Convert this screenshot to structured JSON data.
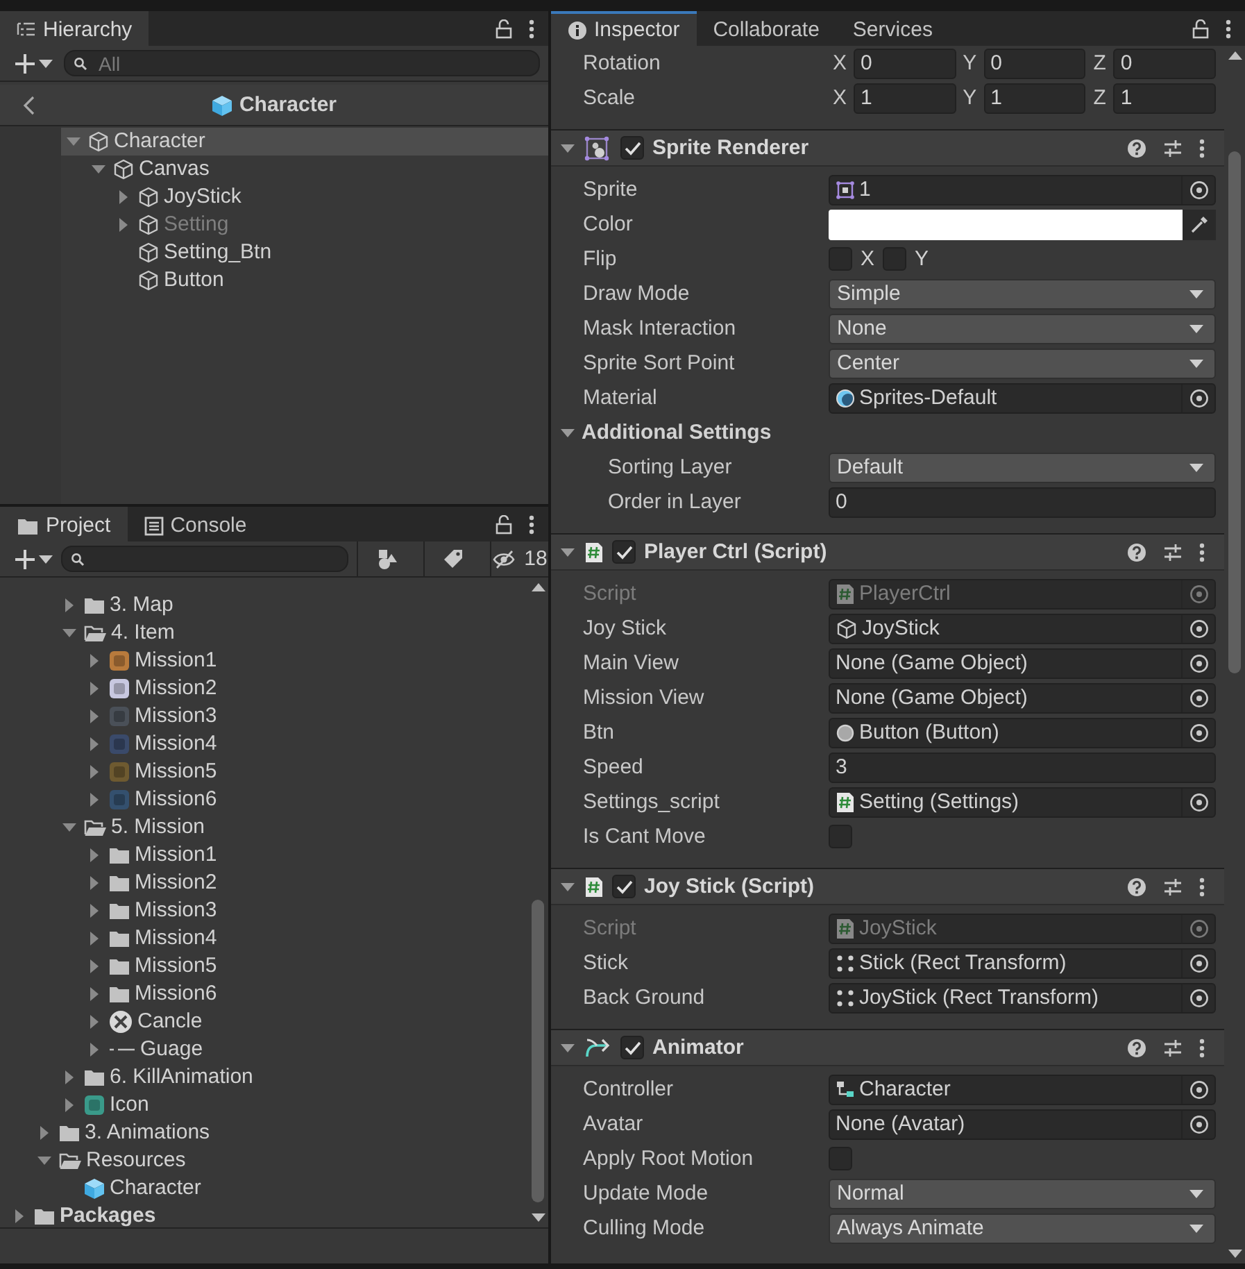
{
  "hierarchy": {
    "tab": {
      "label": "Hierarchy",
      "selected": true
    },
    "search": {
      "placeholder": "All"
    },
    "breadcrumb": "Character",
    "tree": [
      {
        "label": "Character",
        "kind": "gameobject",
        "expanded": true,
        "selected": true,
        "active": true,
        "children": [
          {
            "label": "Canvas",
            "kind": "gameobject",
            "expanded": true,
            "selected": false,
            "active": true,
            "children": [
              {
                "label": "JoyStick",
                "kind": "gameobject",
                "expanded": false,
                "selected": false,
                "active": true
              },
              {
                "label": "Setting",
                "kind": "gameobject",
                "expanded": false,
                "selected": false,
                "active": false
              },
              {
                "label": "Setting_Btn",
                "kind": "gameobject",
                "selected": false,
                "active": true
              },
              {
                "label": "Button",
                "kind": "gameobject",
                "selected": false,
                "active": true
              }
            ]
          }
        ]
      }
    ]
  },
  "project": {
    "tabs": [
      {
        "label": "Project",
        "kind": "folder",
        "selected": true
      },
      {
        "label": "Console",
        "kind": "console",
        "selected": false
      }
    ],
    "hidden_count": "18",
    "tree": [
      {
        "children": [
          {
            "children": [
              {
                "label": "3. Map",
                "kind": "folder",
                "expanded": false
              },
              {
                "label": "4. Item",
                "kind": "folder",
                "expanded": true,
                "children": [
                  {
                    "label": "Mission1",
                    "kind": "thumb",
                    "color": "#b87a3c",
                    "expanded": false
                  },
                  {
                    "label": "Mission2",
                    "kind": "thumb",
                    "color": "#c8c8e0",
                    "expanded": false
                  },
                  {
                    "label": "Mission3",
                    "kind": "thumb",
                    "color": "#4a5058",
                    "expanded": false
                  },
                  {
                    "label": "Mission4",
                    "kind": "thumb",
                    "color": "#3a4a6a",
                    "expanded": false
                  },
                  {
                    "label": "Mission5",
                    "kind": "thumb",
                    "color": "#6e5a30",
                    "expanded": false
                  },
                  {
                    "label": "Mission6",
                    "kind": "thumb",
                    "color": "#34506e",
                    "expanded": false
                  }
                ]
              },
              {
                "label": "5. Mission",
                "kind": "folder",
                "expanded": true,
                "children": [
                  {
                    "label": "Mission1",
                    "kind": "folder",
                    "expanded": false
                  },
                  {
                    "label": "Mission2",
                    "kind": "folder",
                    "expanded": false
                  },
                  {
                    "label": "Mission3",
                    "kind": "folder",
                    "expanded": false
                  },
                  {
                    "label": "Mission4",
                    "kind": "folder",
                    "expanded": false
                  },
                  {
                    "label": "Mission5",
                    "kind": "folder",
                    "expanded": false
                  },
                  {
                    "label": "Mission6",
                    "kind": "folder",
                    "expanded": false
                  },
                  {
                    "label": "Cancle",
                    "kind": "cancel",
                    "expanded": false
                  },
                  {
                    "label": "Guage",
                    "kind": "gauge",
                    "expanded": false
                  }
                ]
              },
              {
                "label": "6. KillAnimation",
                "kind": "folder",
                "expanded": false
              },
              {
                "label": "Icon",
                "kind": "thumb",
                "color": "#3a9a8a",
                "expanded": false
              }
            ]
          },
          {
            "label": "3. Animations",
            "kind": "folder",
            "expanded": false
          },
          {
            "label": "Resources",
            "kind": "folder",
            "expanded": true,
            "children": [
              {
                "label": "Character",
                "kind": "prefab"
              }
            ]
          }
        ]
      },
      {
        "label": "Packages",
        "kind": "folder",
        "expanded": false,
        "bold": true
      }
    ]
  },
  "inspector": {
    "tabs": [
      {
        "label": "Inspector",
        "selected": true
      },
      {
        "label": "Collaborate",
        "selected": false
      },
      {
        "label": "Services",
        "selected": false
      }
    ],
    "transform_rows": [
      {
        "label": "Rotation",
        "axes": [
          {
            "axis": "X",
            "value": "0"
          },
          {
            "axis": "Y",
            "value": "0"
          },
          {
            "axis": "Z",
            "value": "0"
          }
        ]
      },
      {
        "label": "Scale",
        "axes": [
          {
            "axis": "X",
            "value": "1"
          },
          {
            "axis": "Y",
            "value": "1"
          },
          {
            "axis": "Z",
            "value": "1"
          }
        ]
      }
    ],
    "components": [
      {
        "title": "Sprite Renderer",
        "kind": "renderer",
        "enabled": true,
        "expanded": true,
        "fields": [
          {
            "kind": "sprite",
            "label": "Sprite",
            "value": "1",
            "disabled": false
          },
          {
            "kind": "color",
            "label": "Color",
            "color": "#ffffff"
          },
          {
            "kind": "flip",
            "label": "Flip",
            "options": [
              {
                "label": "X",
                "checked": false
              },
              {
                "label": "Y",
                "checked": false
              }
            ]
          },
          {
            "kind": "dropdown",
            "label": "Draw Mode",
            "value": "Simple"
          },
          {
            "kind": "dropdown",
            "label": "Mask Interaction",
            "value": "None"
          },
          {
            "kind": "dropdown",
            "label": "Sprite Sort Point",
            "value": "Center"
          },
          {
            "kind": "material",
            "label": "Material",
            "value": "Sprites-Default",
            "disabled": false
          },
          {
            "kind": "foldout",
            "label": "Additional Settings",
            "expanded": true,
            "children": [
              {
                "kind": "dropdown",
                "label": "Sorting Layer",
                "value": "Default"
              },
              {
                "kind": "text",
                "label": "Order in Layer",
                "value": "0"
              }
            ]
          }
        ]
      },
      {
        "title": "Player Ctrl (Script)",
        "kind": "script",
        "enabled": true,
        "expanded": true,
        "fields": [
          {
            "kind": "script",
            "label": "Script",
            "value": "PlayerCtrl",
            "disabled": true
          },
          {
            "kind": "gameobject",
            "label": "Joy Stick",
            "value": "JoyStick",
            "disabled": false
          },
          {
            "kind": "reference",
            "label": "Main View",
            "value": "None (Game Object)",
            "disabled": false
          },
          {
            "kind": "reference",
            "label": "Mission View",
            "value": "None (Game Object)",
            "disabled": false
          },
          {
            "kind": "button",
            "label": "Btn",
            "value": "Button (Button)",
            "disabled": false
          },
          {
            "kind": "text",
            "label": "Speed",
            "value": "3"
          },
          {
            "kind": "script",
            "label": "Settings_script",
            "value": "Setting (Settings)",
            "disabled": false
          },
          {
            "kind": "checkbox",
            "label": "Is Cant Move",
            "checked": false
          }
        ]
      },
      {
        "title": "Joy Stick (Script)",
        "kind": "script",
        "enabled": true,
        "expanded": true,
        "fields": [
          {
            "kind": "script",
            "label": "Script",
            "value": "JoyStick",
            "disabled": true
          },
          {
            "kind": "rect",
            "label": "Stick",
            "value": "Stick (Rect Transform)",
            "disabled": false
          },
          {
            "kind": "rect",
            "label": "Back Ground",
            "value": "JoyStick (Rect Transform)",
            "disabled": false
          }
        ]
      },
      {
        "title": "Animator",
        "kind": "animator",
        "enabled": true,
        "expanded": true,
        "fields": [
          {
            "kind": "controller",
            "label": "Controller",
            "value": "Character",
            "disabled": false
          },
          {
            "kind": "reference",
            "label": "Avatar",
            "value": "None (Avatar)",
            "disabled": false
          },
          {
            "kind": "checkbox",
            "label": "Apply Root Motion",
            "checked": false
          },
          {
            "kind": "dropdown",
            "label": "Update Mode",
            "value": "Normal"
          },
          {
            "kind": "dropdown",
            "label": "Culling Mode",
            "value": "Always Animate"
          }
        ]
      }
    ]
  }
}
